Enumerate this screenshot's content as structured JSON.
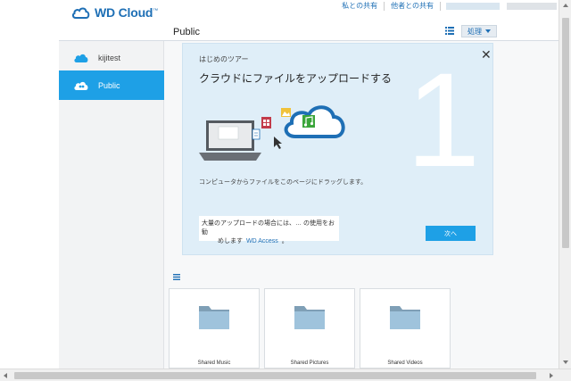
{
  "app": {
    "logo_text": "WD Cloud",
    "logo_tm": "™"
  },
  "header": {
    "links": [
      "私との共有",
      "他者との共有"
    ],
    "page_title": "Public",
    "actions_label": "処理"
  },
  "sidebar": {
    "items": [
      {
        "label": "kijitest",
        "icon": "cloud-icon"
      },
      {
        "label": "Public",
        "icon": "shared-cloud-icon",
        "selected": true
      }
    ]
  },
  "tour": {
    "subtitle": "はじめのツアー",
    "heading": "クラウドにファイルをアップロードする",
    "step_number": "1",
    "description": "コンピュータからファイルをこのページにドラッグします。",
    "note_line1": "大量のアップロードの場合には、… の使用をお勧",
    "note_line2_prefix": "めします",
    "note_link": "WD Access",
    "note_suffix": "。",
    "next_label": "次へ",
    "close_label": "✕"
  },
  "folders": [
    {
      "label": "Shared Music"
    },
    {
      "label": "Shared Pictures"
    },
    {
      "label": "Shared Videos"
    }
  ],
  "colors": {
    "accent": "#1ea0e6",
    "brand": "#1e6fb5",
    "tour_bg": "#dfeef8",
    "folder": "#9fc3dc"
  }
}
